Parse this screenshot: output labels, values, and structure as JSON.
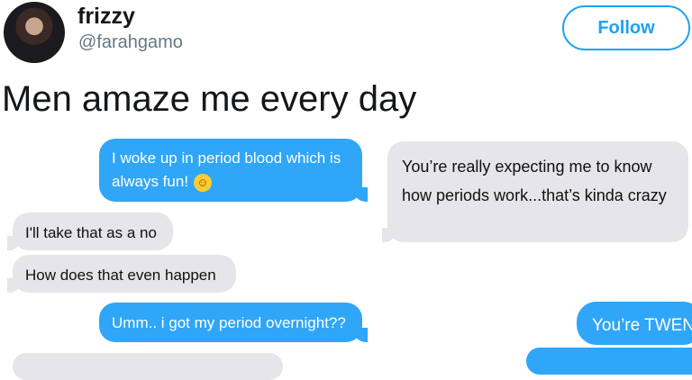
{
  "author": {
    "display_name": "frizzy",
    "handle": "@farahgamo"
  },
  "follow_label": "Follow",
  "tweet_text": "Men amaze me every day",
  "left_screenshot": {
    "messages": [
      {
        "from": "me",
        "color": "#2fa6f8",
        "text": "I woke up in period blood which is always fun!",
        "emoji": "grinning-face-emoji"
      },
      {
        "from": "them",
        "color": "#e5e5ea",
        "text": "I'll take that as a no"
      },
      {
        "from": "them",
        "color": "#e5e5ea",
        "text": "How does that even happen"
      },
      {
        "from": "me",
        "color": "#2fa6f8",
        "text": "Umm.. i got my period overnight??"
      }
    ]
  },
  "right_screenshot": {
    "messages": [
      {
        "from": "them",
        "color": "#e5e5ea",
        "text": "You’re really expecting me to know how periods work...that’s kinda crazy"
      },
      {
        "from": "me",
        "color": "#2fa6f8",
        "text": "You’re TWEN"
      }
    ]
  },
  "colors": {
    "accent": "#1da1f2",
    "imessage_blue": "#2fa6f8",
    "imessage_gray": "#e5e5ea"
  }
}
